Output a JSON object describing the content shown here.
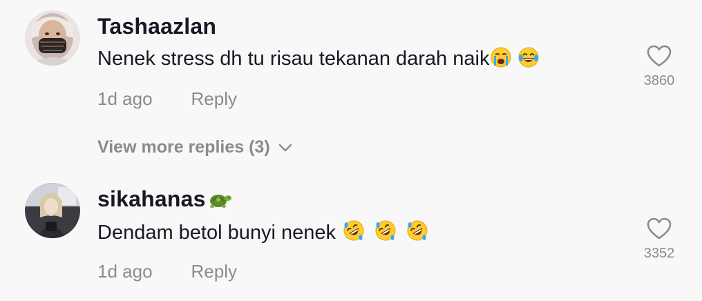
{
  "comments": [
    {
      "username": "Tashaazlan",
      "text": "Nenek stress dh tu risau tekanan darah naik",
      "time": "1d ago",
      "reply_label": "Reply",
      "like_count": "3860",
      "view_more_replies": "View more replies (3)",
      "emojis": [
        "loudly-crying-face",
        "face-with-tears-of-joy"
      ]
    },
    {
      "username": "sikahanas",
      "username_emoji": "turtle",
      "text": "Dendam betol bunyi nenek",
      "time": "1d ago",
      "reply_label": "Reply",
      "like_count": "3352",
      "emojis": [
        "rolling-on-the-floor-laughing",
        "rolling-on-the-floor-laughing",
        "rolling-on-the-floor-laughing"
      ]
    }
  ],
  "colors": {
    "background": "#f8f8f8",
    "primary_text": "#161823",
    "secondary_text": "#8a8b91"
  }
}
